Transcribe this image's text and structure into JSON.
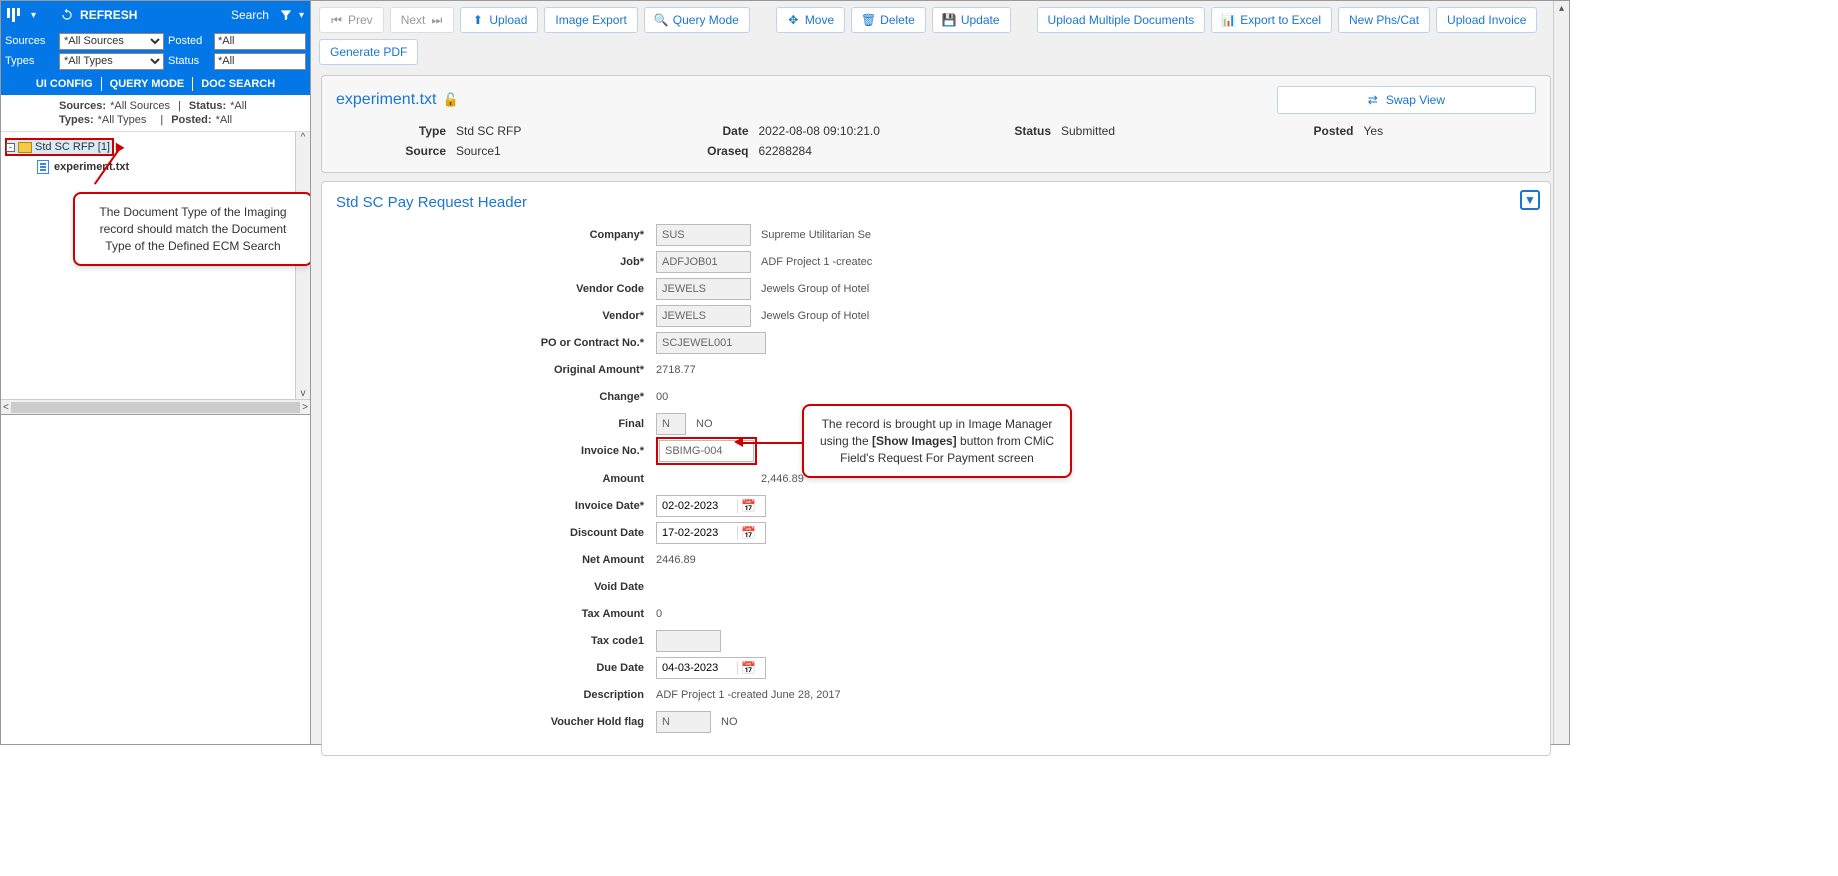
{
  "sidebar": {
    "refresh": "REFRESH",
    "search": "Search",
    "filters": {
      "sources_label": "Sources",
      "sources_value": "*All Sources",
      "posted_label": "Posted",
      "posted_value": "*All",
      "types_label": "Types",
      "types_value": "*All Types",
      "status_label": "Status",
      "status_value": "*All"
    },
    "tabs": {
      "ui_config": "UI CONFIG",
      "query_mode": "QUERY MODE",
      "doc_search": "DOC SEARCH"
    },
    "meta": {
      "sources_label": "Sources:",
      "sources_value": "*All Sources",
      "status_label": "Status:",
      "status_value": "*All",
      "types_label": "Types:",
      "types_value": "*All Types",
      "posted_label": "Posted:",
      "posted_value": "*All"
    },
    "tree": {
      "folder_label": "Std SC RFP [1]",
      "file_label": "experiment.txt"
    }
  },
  "callouts": {
    "left": "The Document Type of the Imaging record should match the Document Type of the Defined ECM Search",
    "right_line1": "The record is brought up in Image Manager using the ",
    "right_bold": "[Show Images]",
    "right_line2": " button from CMiC Field's Request For Payment screen"
  },
  "toolbar": {
    "prev": "Prev",
    "next": "Next",
    "upload": "Upload",
    "image_export": "Image Export",
    "query_mode": "Query Mode",
    "move": "Move",
    "delete": "Delete",
    "update": "Update",
    "upload_multi": "Upload Multiple Documents",
    "export_excel": "Export to Excel",
    "new_phs": "New Phs/Cat",
    "upload_invoice": "Upload Invoice",
    "gen_pdf": "Generate PDF"
  },
  "doc": {
    "title": "experiment.txt",
    "swap": "Swap View",
    "type_label": "Type",
    "type_value": "Std SC RFP",
    "date_label": "Date",
    "date_value": "2022-08-08 09:10:21.0",
    "status_label": "Status",
    "status_value": "Submitted",
    "posted_label": "Posted",
    "posted_value": "Yes",
    "source_label": "Source",
    "source_value": "Source1",
    "oraseq_label": "Oraseq",
    "oraseq_value": "62288284"
  },
  "form": {
    "title": "Std SC Pay Request Header",
    "fields": {
      "company_label": "Company*",
      "company_val": "SUS",
      "company_desc": "Supreme Utilitarian Se",
      "job_label": "Job*",
      "job_val": "ADFJOB01",
      "job_desc": "ADF Project 1 -createc",
      "vendor_code_label": "Vendor Code",
      "vendor_code_val": "JEWELS",
      "vendor_code_desc": "Jewels Group of Hotel",
      "vendor_label": "Vendor*",
      "vendor_val": "JEWELS",
      "vendor_desc": "Jewels Group of Hotel",
      "po_label": "PO or Contract No.*",
      "po_val": "SCJEWEL001",
      "orig_amt_label": "Original Amount*",
      "orig_amt_val": "2718.77",
      "change_label": "Change*",
      "change_val": "00",
      "final_label": "Final",
      "final_val": "N",
      "final_desc": "NO",
      "invoice_no_label": "Invoice No.*",
      "invoice_no_val": "SBIMG-004",
      "amount_label": "Amount",
      "amount_val": "2,446.89",
      "invoice_date_label": "Invoice Date*",
      "invoice_date_val": "02-02-2023",
      "discount_date_label": "Discount Date",
      "discount_date_val": "17-02-2023",
      "net_amount_label": "Net Amount",
      "net_amount_val": "2446.89",
      "void_date_label": "Void Date",
      "tax_amount_label": "Tax Amount",
      "tax_amount_val": "0",
      "tax_code_label": "Tax code1",
      "due_date_label": "Due Date",
      "due_date_val": "04-03-2023",
      "description_label": "Description",
      "description_val": "ADF Project 1 -created June 28, 2017",
      "voucher_label": "Voucher Hold flag",
      "voucher_val": "N",
      "voucher_desc": "NO"
    }
  }
}
